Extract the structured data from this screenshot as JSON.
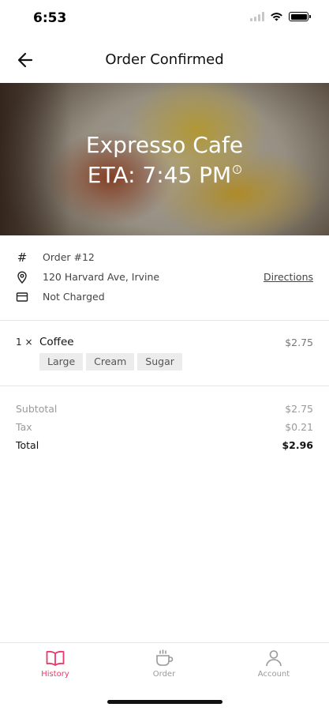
{
  "status_bar": {
    "time": "6:53"
  },
  "nav": {
    "title": "Order Confirmed",
    "back_icon": "arrow-left-icon"
  },
  "hero": {
    "cafe_name": "Expresso Cafe",
    "eta": "ETA: 7:45 PM"
  },
  "details": {
    "order_number": "Order #12",
    "address": "120 Harvard Ave, Irvine",
    "directions_label": "Directions",
    "payment_status": "Not Charged"
  },
  "items": [
    {
      "qty": "1 ×",
      "name": "Coffee",
      "price": "$2.75",
      "modifiers": [
        "Large",
        "Cream",
        "Sugar"
      ]
    }
  ],
  "totals": {
    "subtotal_label": "Subtotal",
    "subtotal": "$2.75",
    "tax_label": "Tax",
    "tax": "$0.21",
    "total_label": "Total",
    "total": "$2.96"
  },
  "tabs": [
    {
      "label": "History",
      "icon": "book-icon",
      "active": true
    },
    {
      "label": "Order",
      "icon": "coffee-cup-icon",
      "active": false
    },
    {
      "label": "Account",
      "icon": "person-icon",
      "active": false
    }
  ],
  "colors": {
    "accent": "#e8396a",
    "muted": "#999999"
  }
}
